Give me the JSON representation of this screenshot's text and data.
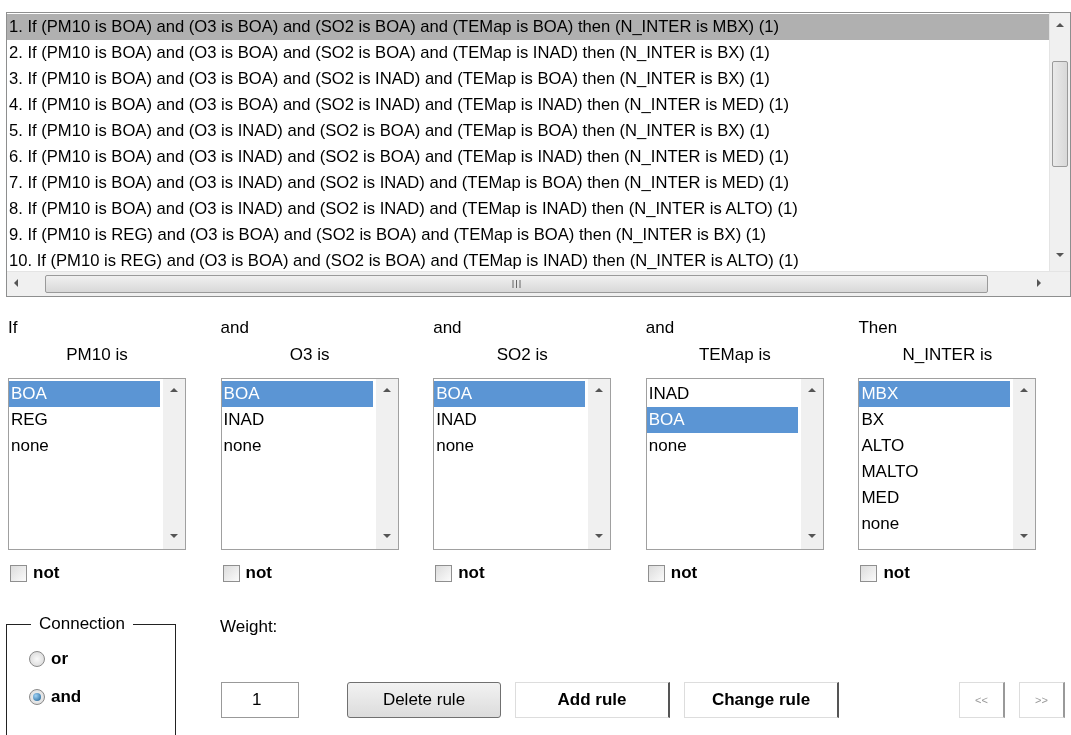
{
  "rules": {
    "items": [
      {
        "text": "1. If (PM10 is BOA) and (O3 is BOA) and (SO2 is BOA) and (TEMap is BOA) then (N_INTER is MBX) (1)",
        "selected": true
      },
      {
        "text": "2. If (PM10 is BOA) and (O3 is BOA) and (SO2 is BOA) and (TEMap is INAD) then (N_INTER is BX) (1)",
        "selected": false
      },
      {
        "text": "3. If (PM10 is BOA) and (O3 is BOA) and (SO2 is INAD) and (TEMap is BOA) then (N_INTER is BX) (1)",
        "selected": false
      },
      {
        "text": "4. If (PM10 is BOA) and (O3 is BOA) and (SO2 is INAD) and (TEMap is INAD) then (N_INTER is MED) (1)",
        "selected": false
      },
      {
        "text": "5. If (PM10 is BOA) and (O3 is INAD) and (SO2 is BOA) and (TEMap is BOA) then (N_INTER is BX) (1)",
        "selected": false
      },
      {
        "text": "6. If (PM10 is BOA) and (O3 is INAD) and (SO2 is BOA) and (TEMap is INAD) then (N_INTER is MED) (1)",
        "selected": false
      },
      {
        "text": "7. If (PM10 is BOA) and (O3 is INAD) and (SO2 is INAD) and (TEMap is BOA) then (N_INTER is MED) (1)",
        "selected": false
      },
      {
        "text": "8. If (PM10 is BOA) and (O3 is INAD) and (SO2 is INAD) and (TEMap is INAD) then (N_INTER is ALTO) (1)",
        "selected": false
      },
      {
        "text": "9. If (PM10 is REG) and (O3 is BOA) and (SO2 is BOA) and (TEMap is BOA) then (N_INTER is BX) (1)",
        "selected": false
      },
      {
        "text": "10. If (PM10 is REG) and (O3 is BOA) and (SO2 is BOA) and (TEMap is INAD) then (N_INTER is ALTO) (1)",
        "selected": false
      }
    ]
  },
  "variables": [
    {
      "connector": "If",
      "label": "PM10 is",
      "options": [
        {
          "text": "BOA",
          "selected": true
        },
        {
          "text": "REG",
          "selected": false
        },
        {
          "text": "none",
          "selected": false
        }
      ],
      "not": {
        "label": "not",
        "checked": false
      }
    },
    {
      "connector": "and",
      "label": "O3 is",
      "options": [
        {
          "text": "BOA",
          "selected": true
        },
        {
          "text": "INAD",
          "selected": false
        },
        {
          "text": "none",
          "selected": false
        }
      ],
      "not": {
        "label": "not",
        "checked": false
      }
    },
    {
      "connector": "and",
      "label": "SO2 is",
      "options": [
        {
          "text": "BOA",
          "selected": true
        },
        {
          "text": "INAD",
          "selected": false
        },
        {
          "text": "none",
          "selected": false
        }
      ],
      "not": {
        "label": "not",
        "checked": false
      }
    },
    {
      "connector": "and",
      "label": "TEMap is",
      "options": [
        {
          "text": "INAD",
          "selected": false
        },
        {
          "text": "BOA",
          "selected": true
        },
        {
          "text": "none",
          "selected": false
        }
      ],
      "not": {
        "label": "not",
        "checked": false
      }
    },
    {
      "connector": "Then",
      "label": "N_INTER is",
      "options": [
        {
          "text": "MBX",
          "selected": true
        },
        {
          "text": "BX",
          "selected": false
        },
        {
          "text": "ALTO",
          "selected": false
        },
        {
          "text": "MALTO",
          "selected": false
        },
        {
          "text": "MED",
          "selected": false
        },
        {
          "text": "none",
          "selected": false
        }
      ],
      "not": {
        "label": "not",
        "checked": false
      }
    }
  ],
  "connection": {
    "title": "Connection",
    "options": [
      {
        "label": "or",
        "selected": false
      },
      {
        "label": "and",
        "selected": true
      }
    ]
  },
  "weight": {
    "label": "Weight:",
    "value": "1"
  },
  "buttons": [
    {
      "label": "Delete rule",
      "kind": "raised"
    },
    {
      "label": "Add rule",
      "kind": "flat"
    },
    {
      "label": "Change rule",
      "kind": "flat"
    }
  ],
  "nav_buttons": [
    {
      "label": "<<",
      "disabled": true
    },
    {
      "label": ">>",
      "disabled": true
    }
  ]
}
